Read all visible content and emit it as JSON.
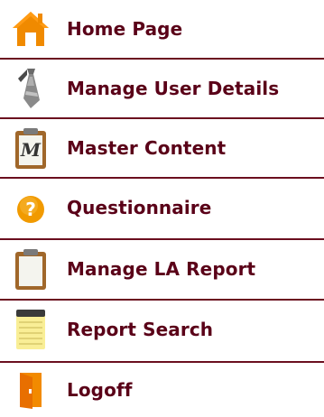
{
  "menu": {
    "items": [
      {
        "label": "Home Page",
        "icon": "home-icon"
      },
      {
        "label": "Manage User Details",
        "icon": "tie-icon"
      },
      {
        "label": "Master Content",
        "icon": "clipboard-m-icon"
      },
      {
        "label": "Questionnaire",
        "icon": "question-icon"
      },
      {
        "label": "Manage LA Report",
        "icon": "clipboard-icon"
      },
      {
        "label": "Report Search",
        "icon": "notepad-icon"
      },
      {
        "label": "Logoff",
        "icon": "door-icon"
      }
    ]
  },
  "colors": {
    "label_text": "#5a0018",
    "divider": "#6b0f1f",
    "background": "#ffffff"
  }
}
